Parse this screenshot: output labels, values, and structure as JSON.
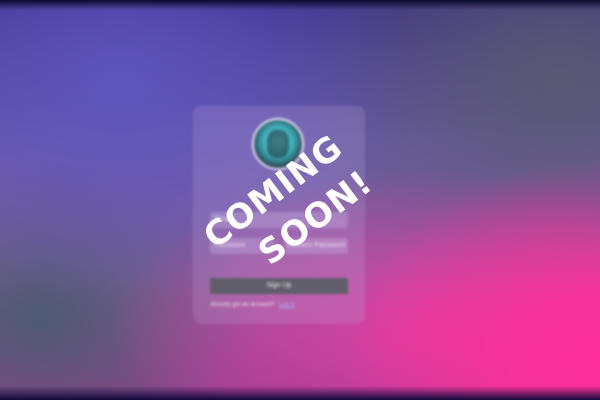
{
  "overlay": {
    "line1": "COMING",
    "line2": "SOON!"
  },
  "form": {
    "email_placeholder": "Email",
    "password_placeholder": "Password",
    "confirm_password_placeholder": "Confirm Password",
    "signup_label": "Sign Up",
    "footer_text": "Already got an account?",
    "login_link": "Log in"
  },
  "colors": {
    "accent_pink": "#ff2f9b",
    "background_purple": "#4a3a8a",
    "button_gray": "#5f5e6a"
  },
  "icons": {
    "avatar": "user-avatar-icon"
  }
}
